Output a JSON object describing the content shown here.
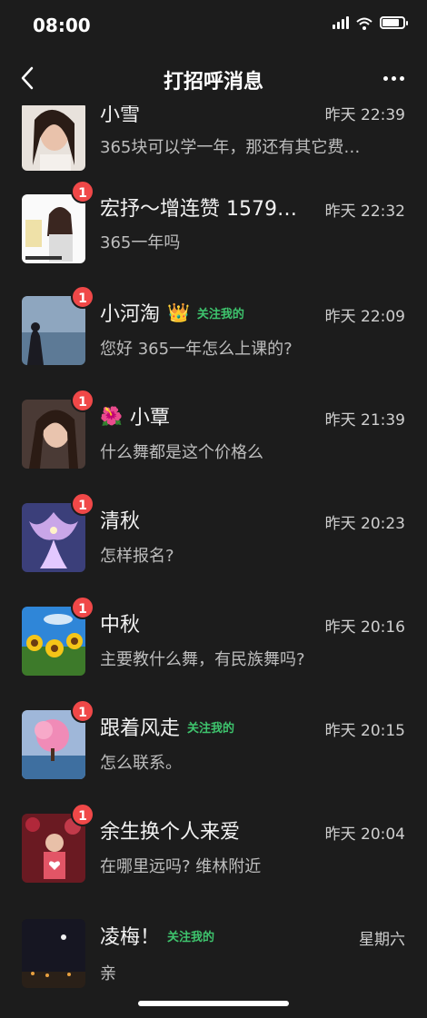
{
  "status": {
    "time": "08:00"
  },
  "nav": {
    "title": "打招呼消息"
  },
  "conversations": [
    {
      "name": "小雪",
      "time": "昨天 22:39",
      "message": "365块可以学一年，那还有其它费…",
      "badge": "",
      "follow_tag": "",
      "prefix_emoji": "",
      "suffix_emoji": ""
    },
    {
      "name": "宏抒～增连赞 1579…",
      "time": "昨天 22:32",
      "message": "365一年吗",
      "badge": "1",
      "follow_tag": "",
      "prefix_emoji": "",
      "suffix_emoji": ""
    },
    {
      "name": "小河淘",
      "time": "昨天 22:09",
      "message": "您好 365一年怎么上课的?",
      "badge": "1",
      "follow_tag": "关注我的",
      "prefix_emoji": "",
      "suffix_emoji": "👑"
    },
    {
      "name": "小覃",
      "time": "昨天 21:39",
      "message": "什么舞都是这个价格么",
      "badge": "1",
      "follow_tag": "",
      "prefix_emoji": "🌺",
      "suffix_emoji": ""
    },
    {
      "name": "清秋",
      "time": "昨天 20:23",
      "message": "怎样报名?",
      "badge": "1",
      "follow_tag": "",
      "prefix_emoji": "",
      "suffix_emoji": ""
    },
    {
      "name": "中秋",
      "time": "昨天 20:16",
      "message": "主要教什么舞，有民族舞吗?",
      "badge": "1",
      "follow_tag": "",
      "prefix_emoji": "",
      "suffix_emoji": ""
    },
    {
      "name": "跟着风走",
      "time": "昨天 20:15",
      "message": "怎么联系。",
      "badge": "1",
      "follow_tag": "关注我的",
      "prefix_emoji": "",
      "suffix_emoji": ""
    },
    {
      "name": "余生换个人来爱",
      "time": "昨天 20:04",
      "message": "在哪里远吗? 维林附近",
      "badge": "1",
      "follow_tag": "",
      "prefix_emoji": "",
      "suffix_emoji": ""
    },
    {
      "name": "凌梅！",
      "time": "星期六",
      "message": "亲",
      "badge": "",
      "follow_tag": "关注我的",
      "prefix_emoji": "",
      "suffix_emoji": ""
    }
  ],
  "icons": {
    "back": "chevron-left-icon",
    "more": "more-dots-icon",
    "signal": "signal-icon",
    "wifi": "wifi-icon",
    "battery": "battery-icon"
  },
  "colors": {
    "background": "#1c1c1c",
    "badge": "#f04848",
    "follow_tag": "#3ec46d"
  }
}
